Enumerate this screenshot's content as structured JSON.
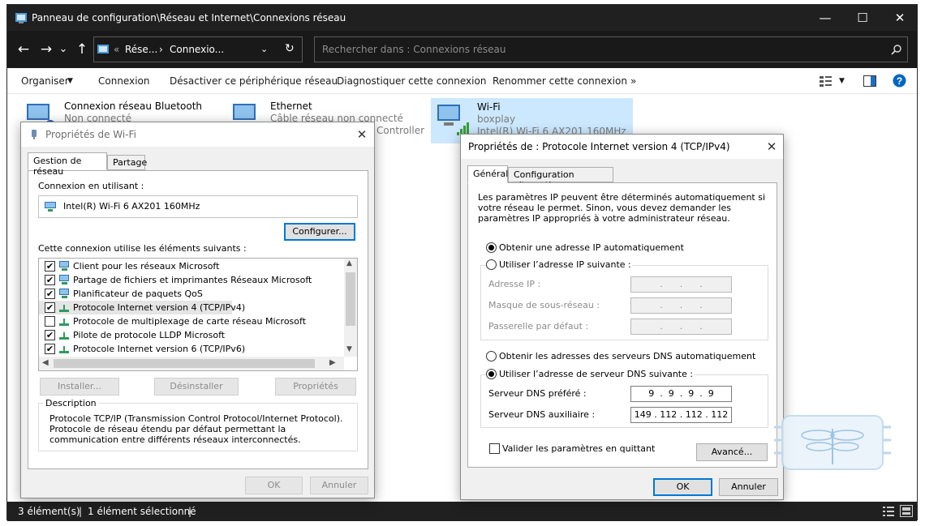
{
  "window": {
    "title": "Panneau de configuration\\Réseau et Internet\\Connexions réseau",
    "controls": {
      "minimize": "—",
      "maximize": "☐",
      "close": "✕"
    }
  },
  "address": {
    "crumb1": "Rése...",
    "crumb2": "Connexio...",
    "sep": "«",
    "arrow": "›"
  },
  "search": {
    "placeholder": "Rechercher dans : Connexions réseau"
  },
  "commands": {
    "organize": "Organiser",
    "connect": "Connexion",
    "disable": "Désactiver ce périphérique réseau",
    "diagnose": "Diagnostiquer cette connexion",
    "rename": "Renommer cette connexion",
    "more": "»"
  },
  "connections": [
    {
      "name": "Connexion réseau Bluetooth",
      "status": "Non connecté",
      "device": ""
    },
    {
      "name": "Ethernet",
      "status": "Câble réseau non connecté",
      "device": "Controller"
    },
    {
      "name": "Wi-Fi",
      "status": "boxplay",
      "device": "Intel(R) Wi-Fi 6 AX201 160MHz"
    }
  ],
  "statusbar": {
    "count": "3 élément(s)",
    "selected": "1 élément sélectionné",
    "sep": "|"
  },
  "wifi_props": {
    "title": "Propriétés de Wi-Fi",
    "tabs": [
      "Gestion de réseau",
      "Partage"
    ],
    "connect_using_label": "Connexion en utilisant :",
    "adapter": "Intel(R) Wi-Fi 6 AX201 160MHz",
    "configure": "Configurer...",
    "items_label": "Cette connexion utilise les éléments suivants :",
    "items": [
      {
        "label": "Client pour les réseaux Microsoft",
        "checked": "✔"
      },
      {
        "label": "Partage de fichiers et imprimantes Réseaux Microsoft",
        "checked": "✔"
      },
      {
        "label": "Planificateur de paquets QoS",
        "checked": "✔"
      },
      {
        "label": "Protocole Internet version 4 (TCP/IPv4)",
        "checked": "✔"
      },
      {
        "label": "Protocole de multiplexage de carte réseau Microsoft",
        "checked": ""
      },
      {
        "label": "Pilote de protocole LLDP Microsoft",
        "checked": "✔"
      },
      {
        "label": "Protocole Internet version 6 (TCP/IPv6)",
        "checked": "✔"
      }
    ],
    "install": "Installer...",
    "uninstall": "Désinstaller",
    "properties": "Propriétés",
    "description_label": "Description",
    "description": "Protocole TCP/IP (Transmission Control Protocol/Internet Protocol). Protocole de réseau étendu par défaut permettant la communication entre différents réseaux interconnectés.",
    "ok": "OK",
    "cancel": "Annuler"
  },
  "ipv4_props": {
    "title": "Propriétés de : Protocole Internet version 4 (TCP/IPv4)",
    "tabs": [
      "Général",
      "Configuration alternative"
    ],
    "intro": "Les paramètres IP peuvent être déterminés automatiquement si votre réseau le permet. Sinon, vous devez demander les paramètres IP appropriés à votre administrateur réseau.",
    "auto_ip": "Obtenir une adresse IP automatiquement",
    "manual_ip": "Utiliser l’adresse IP suivante :",
    "ip_label": "Adresse IP :",
    "mask_label": "Masque de sous-réseau :",
    "gateway_label": "Passerelle par défaut :",
    "empty_ip": "    .      .      .    ",
    "auto_dns": "Obtenir les adresses des serveurs DNS automatiquement",
    "manual_dns": "Utiliser l’adresse de serveur DNS suivante :",
    "dns1_label": "Serveur DNS préféré :",
    "dns2_label": "Serveur DNS auxiliaire :",
    "dns1": "9  .  9  .  9  .  9",
    "dns2": "149 . 112 . 112 . 112",
    "validate": "Valider les paramètres en quittant",
    "advanced": "Avancé...",
    "ok": "OK",
    "cancel": "Annuler"
  },
  "colors": {
    "titlebar": "#202020",
    "accent": "#0078d7",
    "dialog_bg": "#f0f0f0"
  }
}
